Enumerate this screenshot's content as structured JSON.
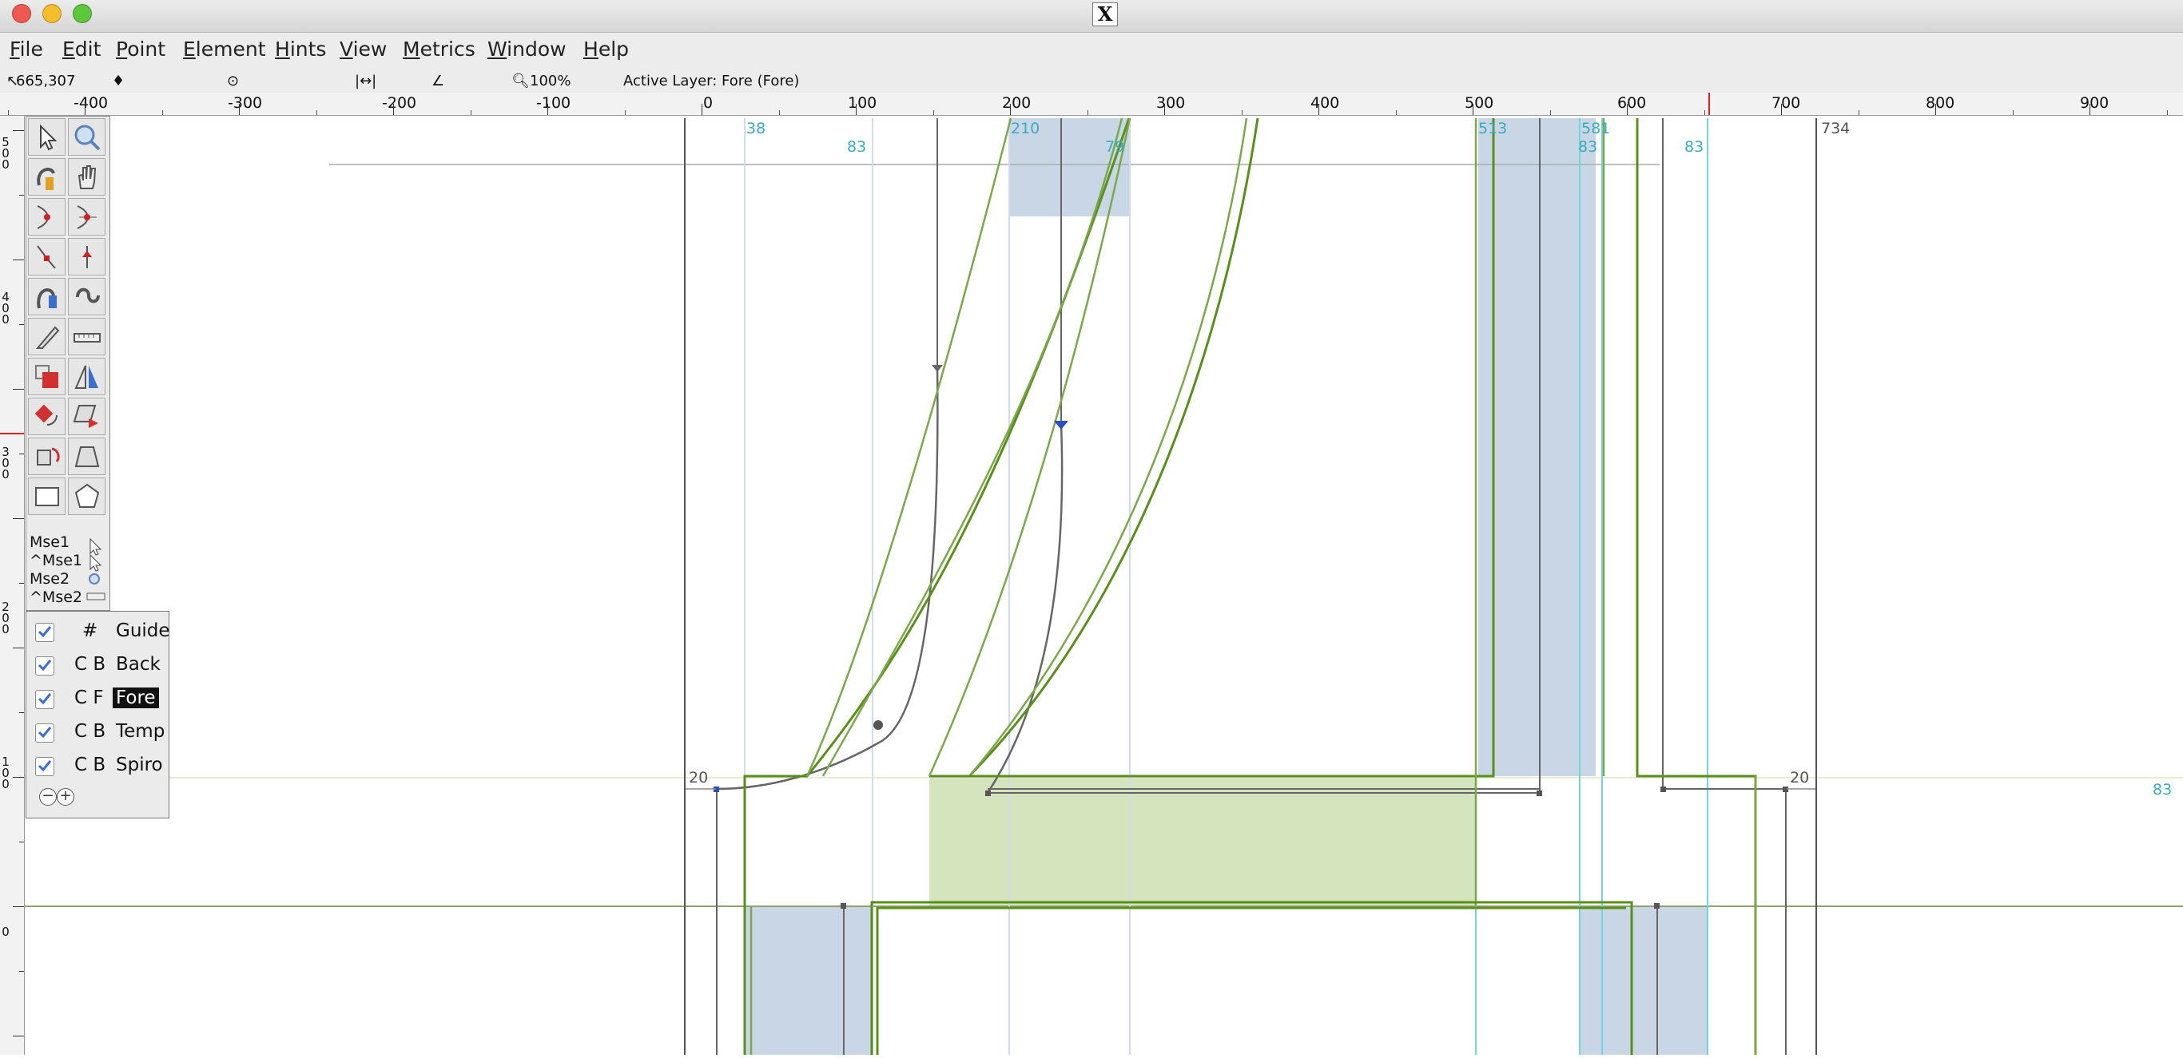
{
  "window": {
    "title": "X"
  },
  "menu": [
    {
      "id": "file",
      "label": "File"
    },
    {
      "id": "edit",
      "label": "Edit"
    },
    {
      "id": "point",
      "label": "Point"
    },
    {
      "id": "element",
      "label": "Element"
    },
    {
      "id": "hints",
      "label": "Hints"
    },
    {
      "id": "view",
      "label": "View"
    },
    {
      "id": "metrics",
      "label": "Metrics"
    },
    {
      "id": "window",
      "label": "Window"
    },
    {
      "id": "help",
      "label": "Help"
    }
  ],
  "status": {
    "coords": "665,307",
    "zoom": "100%",
    "active_layer": "Active Layer: Fore (Fore)"
  },
  "ruler": {
    "labels": [
      "-400",
      "-300",
      "-200",
      "-100",
      "0",
      "100",
      "200",
      "300",
      "400",
      "500",
      "600",
      "700",
      "800",
      "900"
    ],
    "vertical_labels": [
      "5\n0\n0",
      "4\n0\n0",
      "3\n0\n0",
      "2\n0\n0",
      "1\n0\n0",
      "0"
    ]
  },
  "glyph": {
    "hint_labels": [
      "38",
      "83",
      "210",
      "79",
      "513",
      "581",
      "83",
      "83",
      "734"
    ],
    "metric_labels": [
      "20",
      "20",
      "83"
    ]
  },
  "tools": {
    "mouse_labels": [
      "Mse1",
      "^Mse1",
      "Mse2",
      "^Mse2"
    ]
  },
  "layers": [
    {
      "flags": "#",
      "name": "Guide",
      "checked": true,
      "selected": false
    },
    {
      "flags": "C B",
      "name": "Back",
      "checked": true,
      "selected": false
    },
    {
      "flags": "C F",
      "name": "Fore",
      "checked": true,
      "selected": true
    },
    {
      "flags": "C B",
      "name": "Temp",
      "checked": true,
      "selected": false
    },
    {
      "flags": "C B",
      "name": "Spiro",
      "checked": true,
      "selected": false
    }
  ],
  "colors": {
    "outline_green": "#5a8f1c",
    "hint_fill_blue": "#c8d6e6",
    "hint_fill_green": "#d4e4bc",
    "hint_line_cyan": "#70d6dc",
    "hint_text_cyan": "#3aabbd"
  }
}
